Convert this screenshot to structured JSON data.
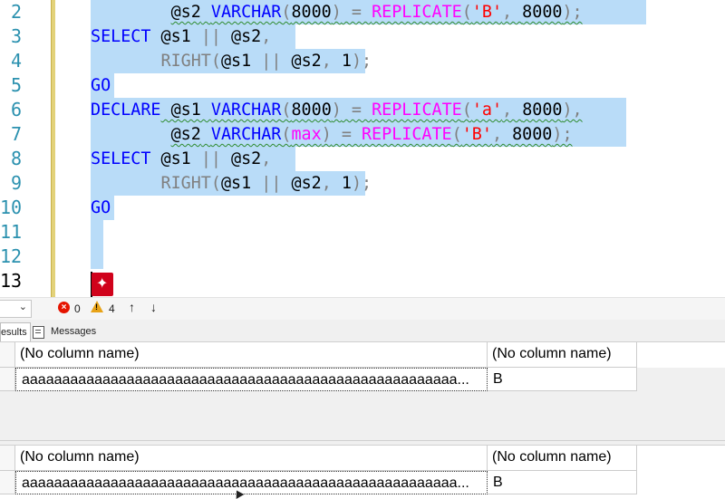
{
  "editor": {
    "line_numbers": [
      "2",
      "3",
      "4",
      "5",
      "6",
      "7",
      "8",
      "9",
      "10",
      "11",
      "12",
      "13"
    ],
    "current_line": "13",
    "lines": [
      [
        {
          "t": "        ",
          "c": ""
        },
        {
          "t": "@s2",
          "c": "var"
        },
        {
          "t": " ",
          "c": ""
        },
        {
          "t": "VARCHAR",
          "c": "kw"
        },
        {
          "t": "(",
          "c": "op"
        },
        {
          "t": "8000",
          "c": "num"
        },
        {
          "t": ")",
          "c": "op"
        },
        {
          "t": " = ",
          "c": "op"
        },
        {
          "t": "REPLICATE",
          "c": "fn"
        },
        {
          "t": "(",
          "c": "op"
        },
        {
          "t": "'B'",
          "c": "str"
        },
        {
          "t": ", ",
          "c": "op"
        },
        {
          "t": "8000",
          "c": "num"
        },
        {
          "t": ");",
          "c": "op"
        }
      ],
      [
        {
          "t": "SELECT",
          "c": "kw"
        },
        {
          "t": " @s1 ",
          "c": "var"
        },
        {
          "t": "||",
          "c": "op"
        },
        {
          "t": " @s2",
          "c": "var"
        },
        {
          "t": ",",
          "c": "op"
        }
      ],
      [
        {
          "t": "       ",
          "c": ""
        },
        {
          "t": "RIGHT",
          "c": "gray"
        },
        {
          "t": "(",
          "c": "op"
        },
        {
          "t": "@s1 ",
          "c": "var"
        },
        {
          "t": "||",
          "c": "op"
        },
        {
          "t": " @s2",
          "c": "var"
        },
        {
          "t": ", ",
          "c": "op"
        },
        {
          "t": "1",
          "c": "num"
        },
        {
          "t": ");",
          "c": "op"
        }
      ],
      [
        {
          "t": "GO",
          "c": "kw"
        }
      ],
      [
        {
          "t": "DECLARE",
          "c": "kw"
        },
        {
          "t": " @s1 ",
          "c": "var"
        },
        {
          "t": "VARCHAR",
          "c": "kw"
        },
        {
          "t": "(",
          "c": "op"
        },
        {
          "t": "8000",
          "c": "num"
        },
        {
          "t": ")",
          "c": "op"
        },
        {
          "t": " = ",
          "c": "op"
        },
        {
          "t": "REPLICATE",
          "c": "fn"
        },
        {
          "t": "(",
          "c": "op"
        },
        {
          "t": "'a'",
          "c": "str"
        },
        {
          "t": ", ",
          "c": "op"
        },
        {
          "t": "8000",
          "c": "num"
        },
        {
          "t": "),",
          "c": "op"
        }
      ],
      [
        {
          "t": "        ",
          "c": ""
        },
        {
          "t": "@s2",
          "c": "var"
        },
        {
          "t": " ",
          "c": ""
        },
        {
          "t": "VARCHAR",
          "c": "kw"
        },
        {
          "t": "(",
          "c": "op"
        },
        {
          "t": "max",
          "c": "fn"
        },
        {
          "t": ")",
          "c": "op"
        },
        {
          "t": " = ",
          "c": "op"
        },
        {
          "t": "REPLICATE",
          "c": "fn"
        },
        {
          "t": "(",
          "c": "op"
        },
        {
          "t": "'B'",
          "c": "str"
        },
        {
          "t": ", ",
          "c": "op"
        },
        {
          "t": "8000",
          "c": "num"
        },
        {
          "t": ");",
          "c": "op"
        }
      ],
      [
        {
          "t": "SELECT",
          "c": "kw"
        },
        {
          "t": " @s1 ",
          "c": "var"
        },
        {
          "t": "||",
          "c": "op"
        },
        {
          "t": " @s2",
          "c": "var"
        },
        {
          "t": ",",
          "c": "op"
        }
      ],
      [
        {
          "t": "       ",
          "c": ""
        },
        {
          "t": "RIGHT",
          "c": "gray"
        },
        {
          "t": "(",
          "c": "op"
        },
        {
          "t": "@s1 ",
          "c": "var"
        },
        {
          "t": "||",
          "c": "op"
        },
        {
          "t": " @s2",
          "c": "var"
        },
        {
          "t": ", ",
          "c": "op"
        },
        {
          "t": "1",
          "c": "num"
        },
        {
          "t": ");",
          "c": "op"
        }
      ],
      [
        {
          "t": "GO",
          "c": "kw"
        }
      ],
      [],
      [],
      []
    ],
    "colors": {
      "keyword": "#0000ff",
      "function": "#ff00ff",
      "string": "#ff00ff",
      "selection": "#add6f7",
      "line_number": "#2b91af"
    }
  },
  "status": {
    "zoom_chevron": "⌄",
    "errors": "0",
    "warnings": "4",
    "error_glyph": "×",
    "warning_glyph": "!",
    "up_glyph": "↑",
    "down_glyph": "↓"
  },
  "tabs": {
    "results": "Results",
    "messages": "Messages"
  },
  "results": [
    {
      "headers": [
        "(No column name)",
        "(No column name)"
      ],
      "rows": [
        [
          "aaaaaaaaaaaaaaaaaaaaaaaaaaaaaaaaaaaaaaaaaaaaaaaaaaaaaa...",
          "B"
        ]
      ]
    },
    {
      "headers": [
        "(No column name)",
        "(No column name)"
      ],
      "rows": [
        [
          "aaaaaaaaaaaaaaaaaaaaaaaaaaaaaaaaaaaaaaaaaaaaaaaaaaaaaa...",
          "B"
        ]
      ]
    }
  ]
}
